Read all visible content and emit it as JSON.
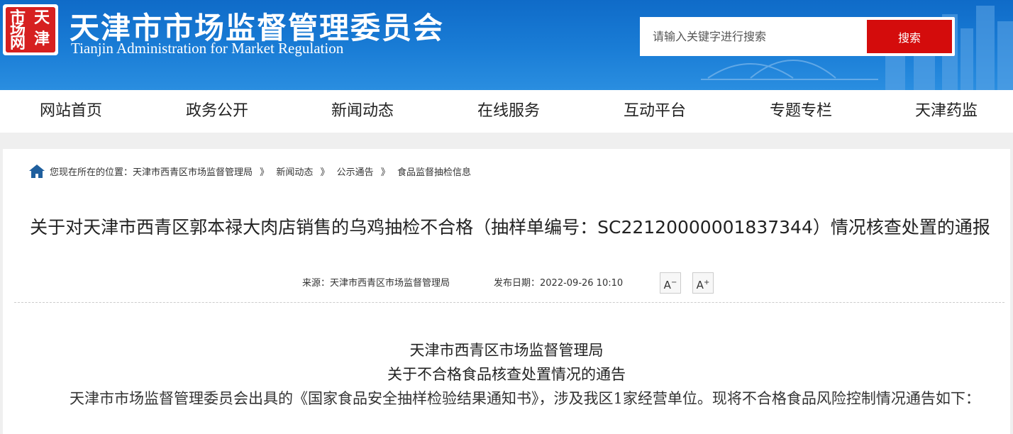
{
  "header": {
    "logo_chars": [
      "天",
      "津",
      "市",
      "场",
      "网"
    ],
    "site_title": "天津市市场监督管理委员会",
    "site_subtitle": "Tianjin Administration for Market Regulation",
    "search_placeholder": "请输入关键字进行搜索",
    "search_button": "搜索"
  },
  "nav": {
    "items": [
      "网站首页",
      "政务公开",
      "新闻动态",
      "在线服务",
      "互动平台",
      "专题专栏",
      "天津药监"
    ]
  },
  "breadcrumb": {
    "prefix": "您现在所在的位置：",
    "items": [
      "天津市西青区市场监督管理局",
      "》",
      "新闻动态",
      "》",
      "公示通告",
      "》",
      "食品监督抽检信息"
    ]
  },
  "article": {
    "title": "关于对天津市西青区郭本禄大肉店销售的乌鸡抽检不合格（抽样单编号：SC22120000001837344）情况核查处置的通报",
    "source": "来源：天津市西青区市场监督管理局",
    "date": "发布日期：2022-09-26 10:10",
    "font_decrease": "A",
    "font_decrease_sign": "−",
    "font_increase": "A",
    "font_increase_sign": "+",
    "heading1": "天津市西青区市场监督管理局",
    "heading2": "关于不合格食品核查处置情况的通告",
    "body": "天津市市场监督管理委员会出具的《国家食品安全抽样检验结果通知书》，涉及我区1家经营单位。现将不合格食品风险控制情况通告如下："
  },
  "colors": {
    "header_blue": "#1a7dd6",
    "search_red": "#d40c0c",
    "seal_red": "#d62020"
  }
}
